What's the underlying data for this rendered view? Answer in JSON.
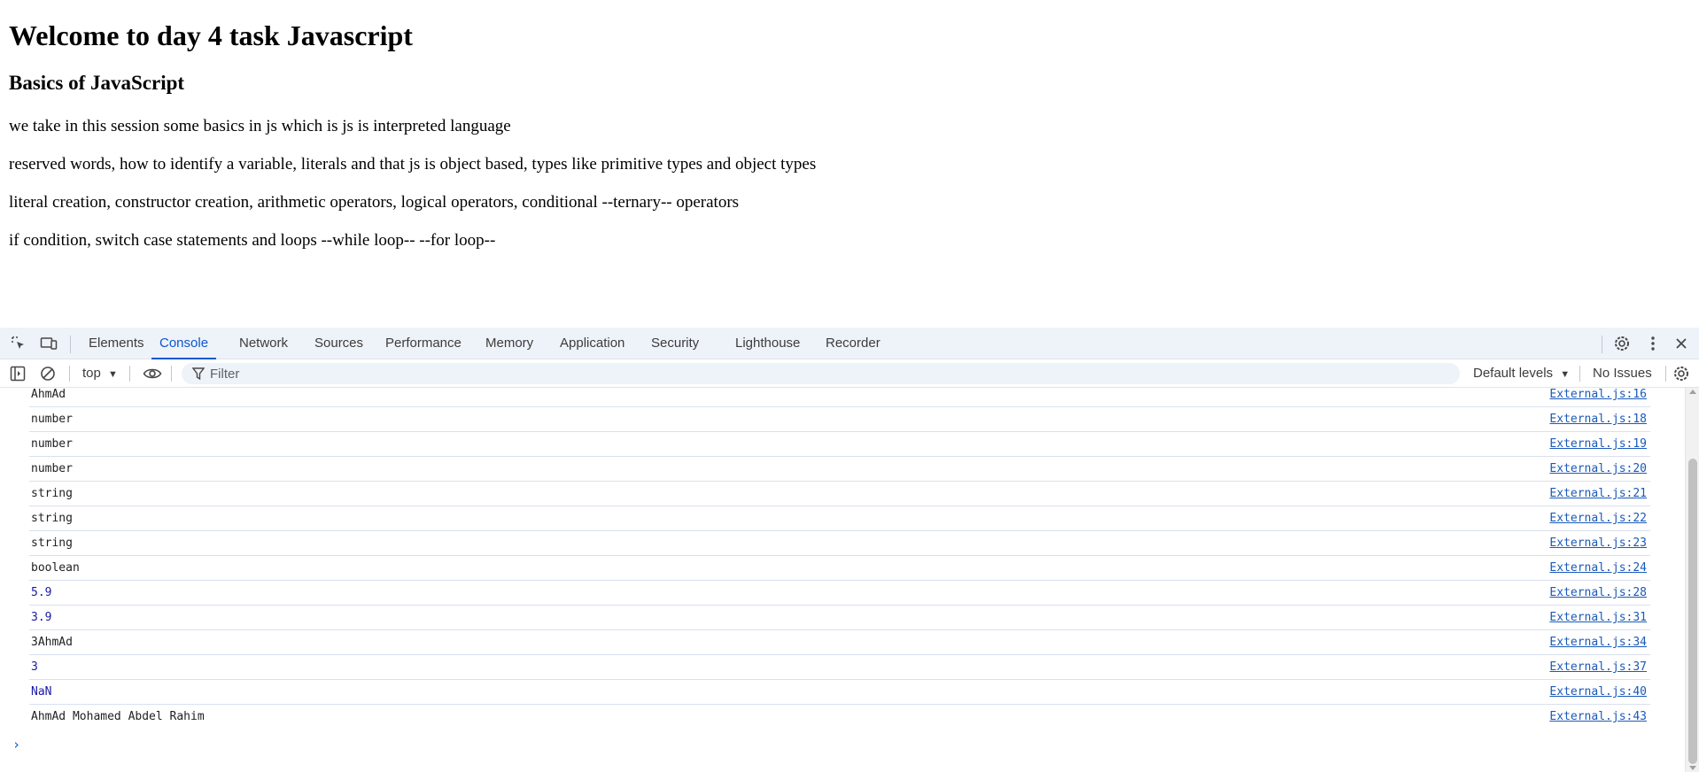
{
  "page": {
    "heading": "Welcome to day 4 task Javascript",
    "subheading": "Basics of JavaScript",
    "paragraphs": [
      "we take in this session some basics in js which is js is interpreted language",
      "reserved words, how to identify a variable, literals and that js is object based, types like primitive types and object types",
      "literal creation, constructor creation, arithmetic operators, logical operators, conditional --ternary-- operators",
      "if condition, switch case statements and loops --while loop-- --for loop--"
    ]
  },
  "devtools": {
    "tabs": [
      "Elements",
      "Console",
      "Network",
      "Sources",
      "Performance",
      "Memory",
      "Application",
      "Security",
      "Lighthouse",
      "Recorder"
    ],
    "active_tab": "Console",
    "toolbar": {
      "context": "top",
      "filter_placeholder": "Filter",
      "levels": "Default levels",
      "issues": "No Issues"
    },
    "messages": [
      {
        "text": "AhmAd",
        "source": "External.js:16",
        "type": "string"
      },
      {
        "text": "number",
        "source": "External.js:18",
        "type": "string"
      },
      {
        "text": "number",
        "source": "External.js:19",
        "type": "string"
      },
      {
        "text": "number",
        "source": "External.js:20",
        "type": "string"
      },
      {
        "text": "string",
        "source": "External.js:21",
        "type": "string"
      },
      {
        "text": "string",
        "source": "External.js:22",
        "type": "string"
      },
      {
        "text": "string",
        "source": "External.js:23",
        "type": "string"
      },
      {
        "text": "boolean",
        "source": "External.js:24",
        "type": "string"
      },
      {
        "text": "5.9",
        "source": "External.js:28",
        "type": "number"
      },
      {
        "text": "3.9",
        "source": "External.js:31",
        "type": "number"
      },
      {
        "text": "3AhmAd",
        "source": "External.js:34",
        "type": "string"
      },
      {
        "text": "3",
        "source": "External.js:37",
        "type": "number"
      },
      {
        "text": "NaN",
        "source": "External.js:40",
        "type": "number"
      },
      {
        "text": "AhmAd Mohamed Abdel Rahim",
        "source": "External.js:43",
        "type": "string"
      }
    ],
    "prompt": "›",
    "colors": {
      "accent": "#0b57d0",
      "tabbar_bg": "#eef2f9",
      "number_value": "#1a1aa6",
      "link": "#1a5ab8"
    }
  }
}
